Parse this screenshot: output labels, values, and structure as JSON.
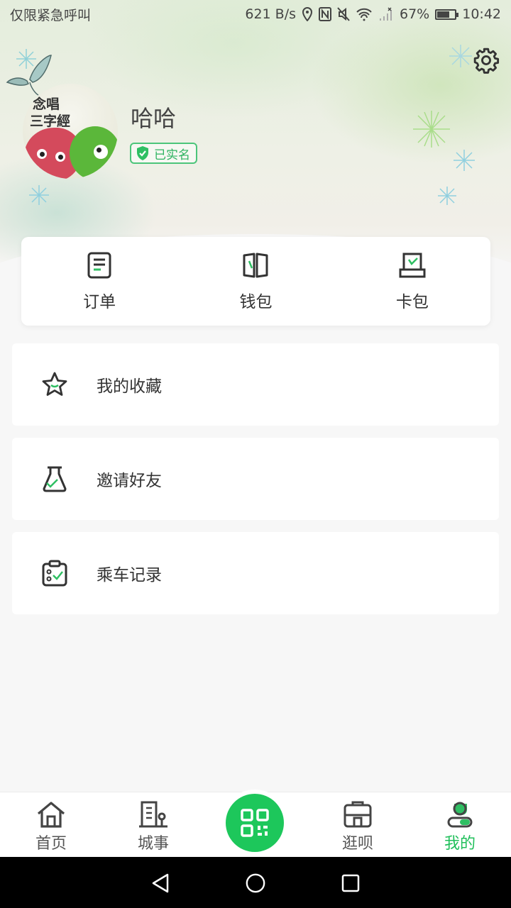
{
  "status_bar": {
    "carrier": "仅限紧急呼叫",
    "speed": "621 B/s",
    "battery": "67%",
    "time": "10:42"
  },
  "profile": {
    "name": "哈哈",
    "verified_badge": "已实名",
    "avatar_text_line1": "念唱",
    "avatar_text_line2": "三字經"
  },
  "quick_actions": [
    {
      "label": "订单",
      "icon": "order-icon"
    },
    {
      "label": "钱包",
      "icon": "wallet-icon"
    },
    {
      "label": "卡包",
      "icon": "card-holder-icon"
    }
  ],
  "menu": [
    {
      "label": "我的收藏",
      "icon": "star-icon"
    },
    {
      "label": "邀请好友",
      "icon": "invite-icon"
    },
    {
      "label": "乘车记录",
      "icon": "ride-record-icon"
    }
  ],
  "bottom_nav": [
    {
      "label": "首页",
      "icon": "home-icon"
    },
    {
      "label": "城事",
      "icon": "city-icon"
    },
    {
      "label": "",
      "icon": "qr-scan-icon"
    },
    {
      "label": "逛呗",
      "icon": "shop-icon"
    },
    {
      "label": "我的",
      "icon": "profile-icon",
      "active": true
    }
  ],
  "colors": {
    "accent": "#1fbf5a",
    "text": "#333333",
    "background": "#f7f7f7"
  }
}
